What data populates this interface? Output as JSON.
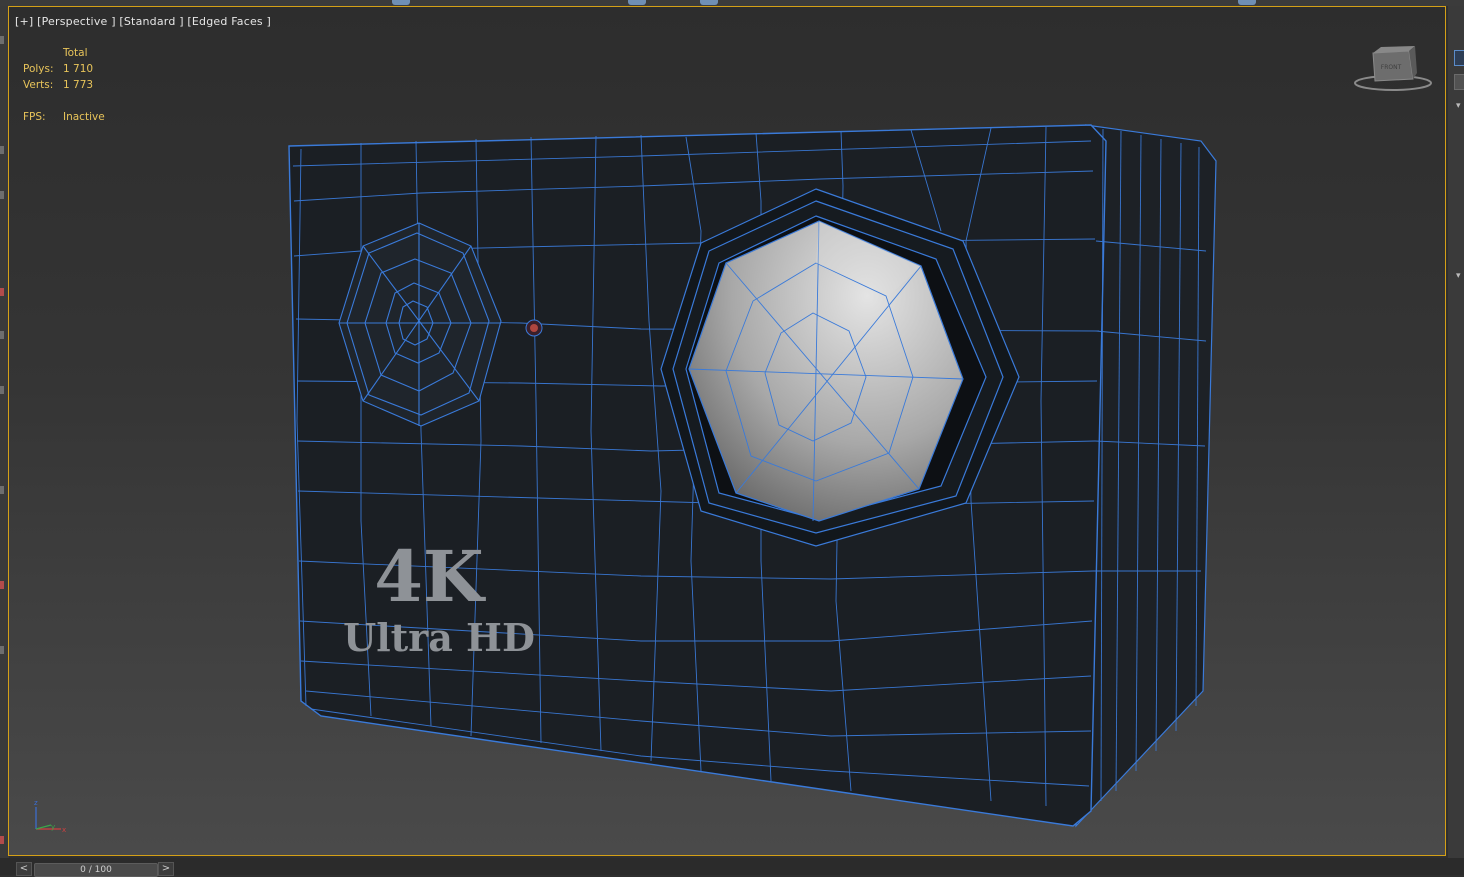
{
  "viewport": {
    "label": "[+] [Perspective ] [Standard ] [Edged Faces ]",
    "border_color": "#d4a017",
    "stats": {
      "header": "Total",
      "polys_label": "Polys:",
      "polys_value": "1 710",
      "verts_label": "Verts:",
      "verts_value": "1 773",
      "fps_label": "FPS:",
      "fps_value": "Inactive"
    },
    "viewcube_label": "FRONT",
    "axis_labels": {
      "z": "z",
      "y": "y",
      "x": "x"
    },
    "model_text": {
      "big": "4K",
      "sub": "Ultra HD"
    },
    "wire_color": "#3a7ad9"
  },
  "timeline": {
    "prev": "<",
    "frame": "0 / 100",
    "next": ">"
  },
  "icons": {
    "viewcube": "view-cube-icon",
    "axis": "axis-tripod-icon"
  }
}
